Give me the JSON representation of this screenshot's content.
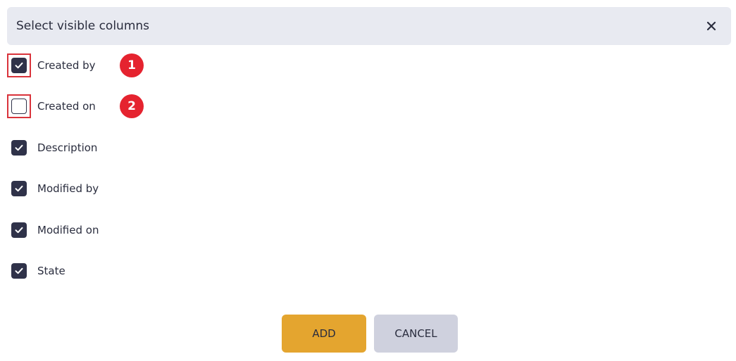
{
  "dialog": {
    "title": "Select visible columns",
    "close_icon": "close-icon"
  },
  "columns": [
    {
      "label": "Created by",
      "checked": true,
      "highlighted": true,
      "marker": "1"
    },
    {
      "label": "Created on",
      "checked": false,
      "highlighted": true,
      "marker": "2"
    },
    {
      "label": "Description",
      "checked": true
    },
    {
      "label": "Modified by",
      "checked": true
    },
    {
      "label": "Modified on",
      "checked": true
    },
    {
      "label": "State",
      "checked": true
    }
  ],
  "buttons": {
    "add_label": "ADD",
    "cancel_label": "CANCEL"
  },
  "colors": {
    "header_bg": "#e8eaf1",
    "checkbox_checked": "#2f3249",
    "highlight_border": "#d9333b",
    "marker_bg": "#e5232f",
    "add_button": "#e4a52f",
    "cancel_button": "#cfd1de"
  }
}
